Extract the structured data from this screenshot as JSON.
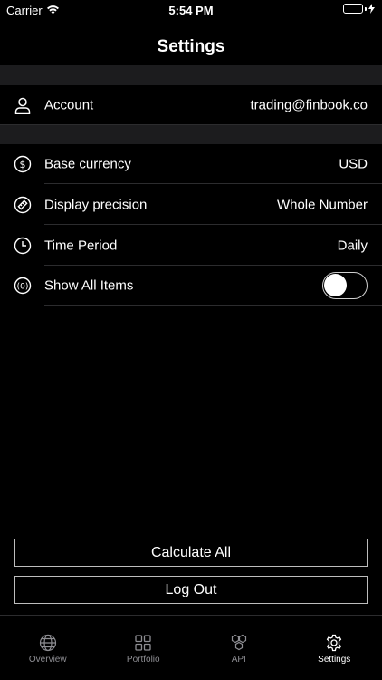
{
  "status_bar": {
    "carrier": "Carrier",
    "time": "5:54 PM",
    "battery_color": "#4cd964"
  },
  "nav": {
    "title": "Settings"
  },
  "account": {
    "label": "Account",
    "value": "trading@finbook.co",
    "icon": "person-icon"
  },
  "settings": [
    {
      "label": "Base currency",
      "value": "USD",
      "icon": "dollar-circle-icon"
    },
    {
      "label": "Display precision",
      "value": "Whole Number",
      "icon": "ruler-circle-icon"
    },
    {
      "label": "Time Period",
      "value": "Daily",
      "icon": "clock-icon"
    },
    {
      "label": "Show All Items",
      "toggle_on": false,
      "icon": "zero-circle-icon"
    }
  ],
  "buttons": {
    "calculate": "Calculate All",
    "logout": "Log Out"
  },
  "tabs": [
    {
      "label": "Overview",
      "icon": "globe-icon",
      "active": false
    },
    {
      "label": "Portfolio",
      "icon": "grid-icon",
      "active": false
    },
    {
      "label": "API",
      "icon": "hexagons-icon",
      "active": false
    },
    {
      "label": "Settings",
      "icon": "gear-icon",
      "active": true
    }
  ]
}
